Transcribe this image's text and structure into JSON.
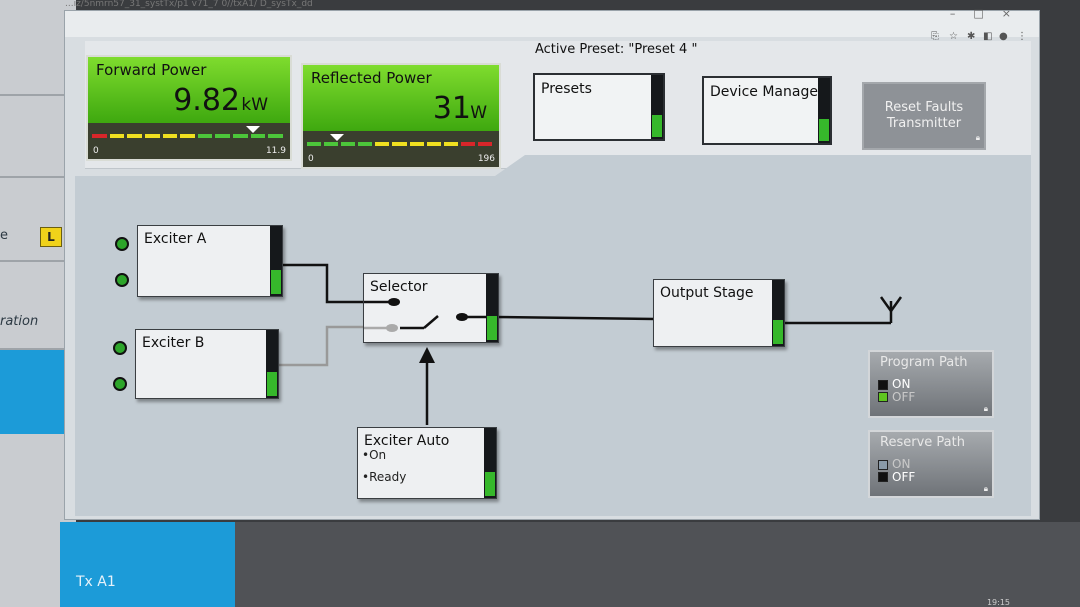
{
  "browser": {
    "url_text": "...iz/5nmrn57_31_systTx/p1 v71_7 0//txA1/ D_sysTx_dd",
    "window_controls": [
      "–",
      "□",
      "×"
    ]
  },
  "header": {
    "active_preset": "Active Preset: \"Preset 4 \""
  },
  "meters": {
    "forward": {
      "title": "Forward Power",
      "value": "9.82",
      "unit": "kW",
      "min": "0",
      "max": "11.9",
      "level_fraction": 0.83
    },
    "reflected": {
      "title": "Reflected Power",
      "value": "31",
      "unit": "W",
      "min": "0",
      "max": "196",
      "level_fraction": 0.16
    }
  },
  "buttons": {
    "presets": "Presets",
    "device_manager": "Device Manager",
    "reset_faults_line1": "Reset Faults",
    "reset_faults_line2": "Transmitter"
  },
  "blocks": {
    "exciter_a": "Exciter A",
    "exciter_b": "Exciter B",
    "selector": "Selector",
    "output_stage": "Output Stage",
    "exciter_auto": {
      "title": "Exciter Auto",
      "line1": "•On",
      "line2": "•Ready"
    }
  },
  "paths": {
    "program": {
      "title": "Program Path",
      "on": "ON",
      "off": "OFF",
      "state": "ON"
    },
    "reserve": {
      "title": "Reserve Path",
      "on": "ON",
      "off": "OFF",
      "state": "OFF"
    }
  },
  "side_panel": {
    "badge": "L",
    "row_letter": "e",
    "row_text": "ration"
  },
  "taskbar": {
    "tab_label": "Tx A1",
    "clock": "19:15"
  },
  "colors": {
    "accent_green": "#36b82b",
    "meter_green": "#5fc51f",
    "host_blue": "#1c9bd8"
  }
}
